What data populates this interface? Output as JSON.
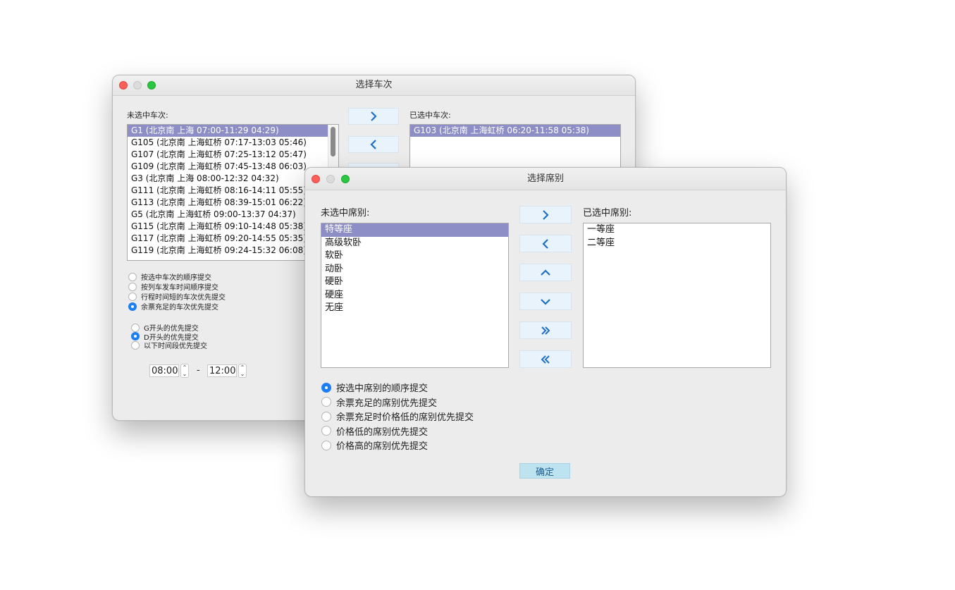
{
  "train_window": {
    "title": "选择车次",
    "unselected_label": "未选中车次:",
    "selected_label": "已选中车次:",
    "unselected_items": [
      {
        "text": "G1 (北京南 上海 07:00-11:29 04:29)",
        "selected": true
      },
      {
        "text": "G105 (北京南 上海虹桥 07:17-13:03 05:46)",
        "selected": false
      },
      {
        "text": "G107 (北京南 上海虹桥 07:25-13:12 05:47)",
        "selected": false
      },
      {
        "text": "G109 (北京南 上海虹桥 07:45-13:48 06:03)",
        "selected": false
      },
      {
        "text": "G3 (北京南 上海 08:00-12:32 04:32)",
        "selected": false
      },
      {
        "text": "G111 (北京南 上海虹桥 08:16-14:11 05:55)",
        "selected": false
      },
      {
        "text": "G113 (北京南 上海虹桥 08:39-15:01 06:22)",
        "selected": false
      },
      {
        "text": "G5 (北京南 上海虹桥 09:00-13:37 04:37)",
        "selected": false
      },
      {
        "text": "G115 (北京南 上海虹桥 09:10-14:48 05:38)",
        "selected": false
      },
      {
        "text": "G117 (北京南 上海虹桥 09:20-14:55 05:35)",
        "selected": false
      },
      {
        "text": "G119 (北京南 上海虹桥 09:24-15:32 06:08)",
        "selected": false
      }
    ],
    "selected_items": [
      {
        "text": "G103 (北京南 上海虹桥 06:20-11:58 05:38)",
        "selected": true
      }
    ],
    "buttons": [
      {
        "icon": "chevron-right-icon"
      },
      {
        "icon": "chevron-left-icon"
      }
    ],
    "order_options": [
      {
        "label": "按选中车次的顺序提交",
        "checked": false
      },
      {
        "label": "按列车发车时间顺序提交",
        "checked": false
      },
      {
        "label": "行程时间短的车次优先提交",
        "checked": false
      },
      {
        "label": "余票充足的车次优先提交",
        "checked": true
      }
    ],
    "priority_options": [
      {
        "label": "G开头的优先提交",
        "checked": false
      },
      {
        "label": "D开头的优先提交",
        "checked": true
      },
      {
        "label": "以下时间段优先提交",
        "checked": false
      }
    ],
    "time_start": "08:00",
    "time_separator": "-",
    "time_end": "12:00"
  },
  "seat_window": {
    "title": "选择席别",
    "unselected_label": "未选中席别:",
    "selected_label": "已选中席别:",
    "unselected_items": [
      {
        "text": "特等座",
        "selected": true
      },
      {
        "text": "高级软卧",
        "selected": false
      },
      {
        "text": "软卧",
        "selected": false
      },
      {
        "text": "动卧",
        "selected": false
      },
      {
        "text": "硬卧",
        "selected": false
      },
      {
        "text": "硬座",
        "selected": false
      },
      {
        "text": "无座",
        "selected": false
      }
    ],
    "selected_items": [
      {
        "text": "一等座",
        "selected": false
      },
      {
        "text": "二等座",
        "selected": false
      }
    ],
    "buttons": [
      {
        "icon": "chevron-right-icon"
      },
      {
        "icon": "chevron-left-icon"
      },
      {
        "icon": "chevron-up-icon"
      },
      {
        "icon": "chevron-down-icon"
      },
      {
        "icon": "double-chevron-right-icon"
      },
      {
        "icon": "double-chevron-left-icon"
      }
    ],
    "order_options": [
      {
        "label": "按选中席别的顺序提交",
        "checked": true
      },
      {
        "label": "余票充足的席别优先提交",
        "checked": false
      },
      {
        "label": "余票充足时价格低的席别优先提交",
        "checked": false
      },
      {
        "label": "价格低的席别优先提交",
        "checked": false
      },
      {
        "label": "价格高的席别优先提交",
        "checked": false
      }
    ],
    "confirm_label": "确定"
  },
  "colors": {
    "selection": "#8e8ec6",
    "arrow": "#1f6fc5",
    "radio_on": "#1b7ef6",
    "confirm_bg": "#bde3f1"
  }
}
